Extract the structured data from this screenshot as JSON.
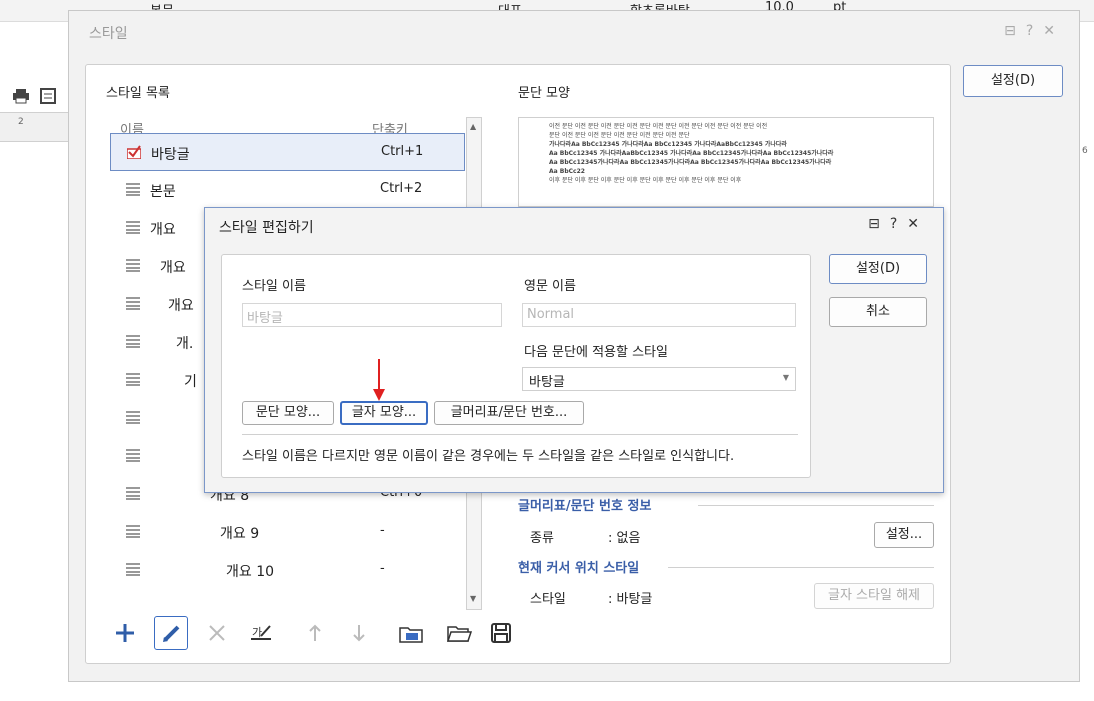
{
  "background": {
    "toolbar_partial_text": "본문",
    "font_select": "대표",
    "font_name": "함초롬바탕",
    "font_size": "10.0",
    "font_unit": "pt",
    "ruler_mark_left": "2",
    "ruler_mark_right": "6"
  },
  "style_dialog": {
    "title": "스타일",
    "setting_button": "설정(D)",
    "list_label": "스타일 목록",
    "col_name": "이름",
    "col_shortcut": "단축키",
    "items": [
      {
        "name": "바탕글",
        "key": "Ctrl+1"
      },
      {
        "name": "본문",
        "key": "Ctrl+2"
      },
      {
        "name": "개요",
        "key": ""
      },
      {
        "name": "개요",
        "key": ""
      },
      {
        "name": "개요",
        "key": ""
      },
      {
        "name": "개.",
        "key": ""
      },
      {
        "name": "기",
        "key": ""
      },
      {
        "name": "",
        "key": ""
      },
      {
        "name": "",
        "key": ""
      },
      {
        "name": "개요 8",
        "key": "Ctrl+0"
      },
      {
        "name": "개요 9",
        "key": "-"
      },
      {
        "name": "개요 10",
        "key": "-"
      }
    ],
    "preview_label": "문단 모양",
    "preview_lines": [
      "이전 문단 이전 문단 이전 문단 이전 문단 이전 문단 이전 문단 이전 문단 이전 문단 이전",
      "문단 이전 문단 이전 문단 이전 문단 이전 문단 이전 문단",
      "가나다라Aa BbCc12345    가나다라Aa BbCc12345    가나다라AaBbCc12345    가나다라",
      "Aa BbCc12345 가나다라AaBbCc12345 가나다라Aa BbCc12345가나다라Aa BbCc12345가나다라",
      "Aa BbCc12345가나다라Aa BbCc12345가나다라Aa BbCc12345가나다라Aa BbCc12345가나다라",
      "Aa BbCc22",
      "이후 문단 이후 문단 이후 문단 이후 문단 이후 문단 이후 문단 이후 문단 이후"
    ],
    "bullet_group": "글머리표/문단 번호 정보",
    "bullet_type_label": "종류",
    "bullet_type_value": ": 없음",
    "bullet_setting": "설정...",
    "cursor_group": "현재 커서 위치 스타일",
    "cursor_style_label": "스타일",
    "cursor_style_value": ": 바탕글",
    "char_style_release": "글자 스타일 해제"
  },
  "edit_dialog": {
    "title": "스타일 편집하기",
    "name_label": "스타일 이름",
    "name_value": "바탕글",
    "eng_label": "영문 이름",
    "eng_value": "Normal",
    "next_label": "다음 문단에 적용할 스타일",
    "next_value": "바탕글",
    "btn_para": "문단 모양...",
    "btn_char": "글자 모양...",
    "btn_bullet": "글머리표/문단 번호...",
    "note": "스타일 이름은 다르지만 영문 이름이 같은 경우에는 두 스타일을 같은 스타일로 인식합니다.",
    "ok": "설정(D)",
    "cancel": "취소"
  },
  "colors": {
    "accent": "#3a5ea8",
    "arrow": "#e02020"
  }
}
